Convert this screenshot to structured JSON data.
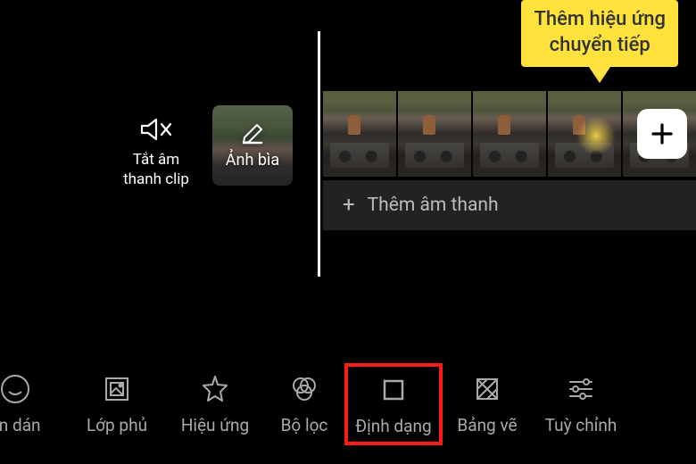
{
  "callout": {
    "line1": "Thêm hiệu ứng",
    "line2": "chuyển tiếp"
  },
  "mute_clip": {
    "label_line1": "Tắt âm",
    "label_line2": "thanh clip"
  },
  "cover_thumb": {
    "label": "Ảnh bìa"
  },
  "audio_track": {
    "label": "Thêm âm thanh"
  },
  "toolbar": {
    "sticker": "ãn dán",
    "overlay": "Lớp phủ",
    "effect": "Hiệu ứng",
    "filter": "Bộ lọc",
    "format": "Định dạng",
    "canvas": "Bảng vẽ",
    "adjust": "Tuỳ chỉnh"
  },
  "highlighted_tool": "format"
}
